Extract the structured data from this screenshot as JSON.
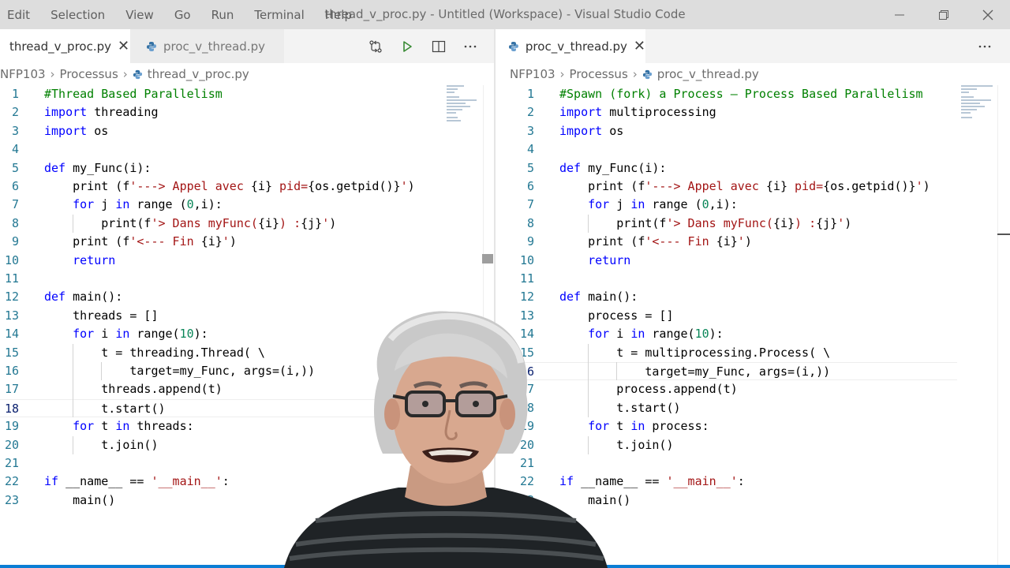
{
  "window": {
    "title": "thread_v_proc.py - Untitled (Workspace) - Visual Studio Code",
    "menu": [
      "Edit",
      "Selection",
      "View",
      "Go",
      "Run",
      "Terminal",
      "Help"
    ]
  },
  "left": {
    "tabs": [
      {
        "label": "thread_v_proc.py",
        "active": true
      },
      {
        "label": "proc_v_thread.py",
        "active": false
      }
    ],
    "breadcrumb": [
      "NFP103",
      "Processus",
      "thread_v_proc.py"
    ],
    "lines": [
      [
        {
          "t": "#Thread Based Parallelism",
          "c": "cm"
        }
      ],
      [
        {
          "t": "import",
          "c": "kw"
        },
        {
          "t": " threading"
        }
      ],
      [
        {
          "t": "import",
          "c": "kw"
        },
        {
          "t": " os"
        }
      ],
      [],
      [
        {
          "t": "def",
          "c": "kw"
        },
        {
          "t": " my_Func(i):"
        }
      ],
      [
        {
          "t": "    print (f"
        },
        {
          "t": "'---> Appel avec ",
          "c": "st"
        },
        {
          "t": "{i}"
        },
        {
          "t": " pid=",
          "c": "st"
        },
        {
          "t": "{os.getpid()}"
        },
        {
          "t": "'",
          "c": "st"
        },
        {
          "t": ")"
        }
      ],
      [
        {
          "t": "    "
        },
        {
          "t": "for",
          "c": "kw"
        },
        {
          "t": " j "
        },
        {
          "t": "in",
          "c": "kw"
        },
        {
          "t": " range ("
        },
        {
          "t": "0",
          "c": "nm"
        },
        {
          "t": ",i):"
        }
      ],
      [
        {
          "t": "        print(f"
        },
        {
          "t": "'> Dans myFunc(",
          "c": "st"
        },
        {
          "t": "{i}"
        },
        {
          "t": ") :",
          "c": "st"
        },
        {
          "t": "{j}"
        },
        {
          "t": "'",
          "c": "st"
        },
        {
          "t": ")"
        }
      ],
      [
        {
          "t": "    print (f"
        },
        {
          "t": "'<--- Fin ",
          "c": "st"
        },
        {
          "t": "{i}"
        },
        {
          "t": "'",
          "c": "st"
        },
        {
          "t": ")"
        }
      ],
      [
        {
          "t": "    "
        },
        {
          "t": "return",
          "c": "kw"
        }
      ],
      [],
      [
        {
          "t": "def",
          "c": "kw"
        },
        {
          "t": " main():"
        }
      ],
      [
        {
          "t": "    threads = []"
        }
      ],
      [
        {
          "t": "    "
        },
        {
          "t": "for",
          "c": "kw"
        },
        {
          "t": " i "
        },
        {
          "t": "in",
          "c": "kw"
        },
        {
          "t": " range("
        },
        {
          "t": "10",
          "c": "nm"
        },
        {
          "t": "):"
        }
      ],
      [
        {
          "t": "        t = threading.Thread( \\"
        }
      ],
      [
        {
          "t": "            target=my_Func, args=(i,))"
        }
      ],
      [
        {
          "t": "        threads.append(t)"
        }
      ],
      [
        {
          "t": "        t.start()"
        }
      ],
      [
        {
          "t": "    "
        },
        {
          "t": "for",
          "c": "kw"
        },
        {
          "t": " t "
        },
        {
          "t": "in",
          "c": "kw"
        },
        {
          "t": " threads:"
        }
      ],
      [
        {
          "t": "        t.join()"
        }
      ],
      [],
      [
        {
          "t": "if",
          "c": "kw"
        },
        {
          "t": " __name__ == "
        },
        {
          "t": "'__main__'",
          "c": "st"
        },
        {
          "t": ":"
        }
      ],
      [
        {
          "t": "    main()"
        }
      ]
    ]
  },
  "right": {
    "tabs": [
      {
        "label": "proc_v_thread.py",
        "active": true
      }
    ],
    "breadcrumb": [
      "NFP103",
      "Processus",
      "proc_v_thread.py"
    ],
    "lines": [
      [
        {
          "t": "#Spawn (fork) a Process – Process Based Parallelism",
          "c": "cm"
        }
      ],
      [
        {
          "t": "import",
          "c": "kw"
        },
        {
          "t": " multiprocessing"
        }
      ],
      [
        {
          "t": "import",
          "c": "kw"
        },
        {
          "t": " os"
        }
      ],
      [],
      [
        {
          "t": "def",
          "c": "kw"
        },
        {
          "t": " my_Func(i):"
        }
      ],
      [
        {
          "t": "    print (f"
        },
        {
          "t": "'---> Appel avec ",
          "c": "st"
        },
        {
          "t": "{i}"
        },
        {
          "t": " pid=",
          "c": "st"
        },
        {
          "t": "{os.getpid()}"
        },
        {
          "t": "'",
          "c": "st"
        },
        {
          "t": ")"
        }
      ],
      [
        {
          "t": "    "
        },
        {
          "t": "for",
          "c": "kw"
        },
        {
          "t": " j "
        },
        {
          "t": "in",
          "c": "kw"
        },
        {
          "t": " range ("
        },
        {
          "t": "0",
          "c": "nm"
        },
        {
          "t": ",i):"
        }
      ],
      [
        {
          "t": "        print(f"
        },
        {
          "t": "'> Dans myFunc(",
          "c": "st"
        },
        {
          "t": "{i}"
        },
        {
          "t": ") :",
          "c": "st"
        },
        {
          "t": "{j}"
        },
        {
          "t": "'",
          "c": "st"
        },
        {
          "t": ")"
        }
      ],
      [
        {
          "t": "    print (f"
        },
        {
          "t": "'<--- Fin ",
          "c": "st"
        },
        {
          "t": "{i}"
        },
        {
          "t": "'",
          "c": "st"
        },
        {
          "t": ")"
        }
      ],
      [
        {
          "t": "    "
        },
        {
          "t": "return",
          "c": "kw"
        }
      ],
      [],
      [
        {
          "t": "def",
          "c": "kw"
        },
        {
          "t": " main():"
        }
      ],
      [
        {
          "t": "    process = []"
        }
      ],
      [
        {
          "t": "    "
        },
        {
          "t": "for",
          "c": "kw"
        },
        {
          "t": " i "
        },
        {
          "t": "in",
          "c": "kw"
        },
        {
          "t": " range("
        },
        {
          "t": "10",
          "c": "nm"
        },
        {
          "t": "):"
        }
      ],
      [
        {
          "t": "        t = multiprocessing.Process( \\"
        }
      ],
      [
        {
          "t": "            target=my_Func, args=(i,))"
        }
      ],
      [
        {
          "t": "        process.append(t)"
        }
      ],
      [
        {
          "t": "        t.start()"
        }
      ],
      [
        {
          "t": "    "
        },
        {
          "t": "for",
          "c": "kw"
        },
        {
          "t": " t "
        },
        {
          "t": "in",
          "c": "kw"
        },
        {
          "t": " process:"
        }
      ],
      [
        {
          "t": "        t.join()"
        }
      ],
      [],
      [
        {
          "t": "if",
          "c": "kw"
        },
        {
          "t": " __name__ == "
        },
        {
          "t": "'__main__'",
          "c": "st"
        },
        {
          "t": ":"
        }
      ],
      [
        {
          "t": "    main()"
        }
      ]
    ]
  }
}
